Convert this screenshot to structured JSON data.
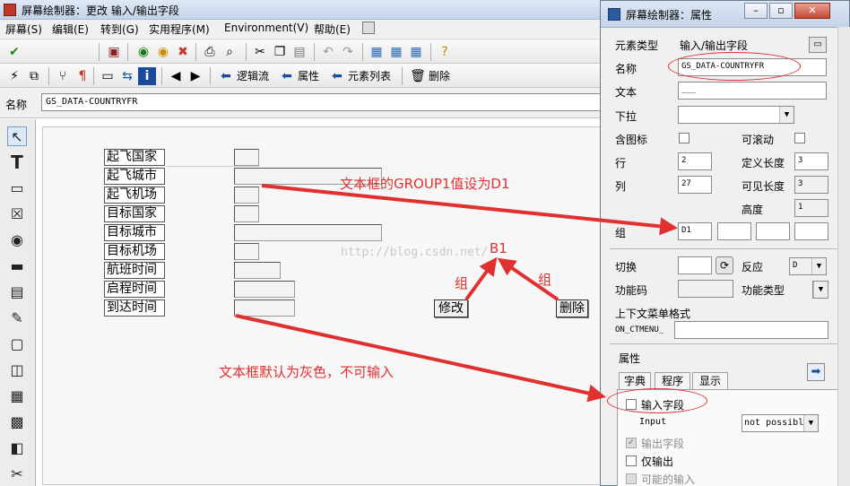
{
  "window": {
    "title": "屏幕绘制器：更改 输入/输出字段"
  },
  "menu": [
    "屏幕(S)",
    "编辑(E)",
    "转到(G)",
    "实用程序(M)",
    "Environment(V)",
    "帮助(E)"
  ],
  "toolbar2": {
    "logic_flow": "逻辑流",
    "attributes": "属性",
    "element_list": "元素列表",
    "delete": "删除"
  },
  "namebar": {
    "label": "名称",
    "value": "GS_DATA-COUNTRYFR"
  },
  "canvas": {
    "labels": [
      "起飞国家",
      "起飞城市",
      "起飞机场",
      "目标国家",
      "目标城市",
      "目标机场",
      "航班时间",
      "启程时间",
      "到达时间"
    ],
    "buttons": {
      "modify": "修改",
      "delete": "删除"
    }
  },
  "annotations": {
    "group1_d1": "文本框的GROUP1值设为D1",
    "b1": "B1",
    "group_left": "组",
    "group_right": "组",
    "watermark": "http://blog.csdn.net/",
    "gray_default": "文本框默认为灰色，不可输入"
  },
  "props": {
    "title": "屏幕绘制器：属性",
    "element_type_label": "元素类型",
    "element_type_value": "输入/输出字段",
    "name_label": "名称",
    "name_value": "GS_DATA-COUNTRYFR",
    "text_label": "文本",
    "text_value": "___",
    "dropdown_label": "下拉",
    "with_icon_label": "含图标",
    "scrollable_label": "可滚动",
    "row_label": "行",
    "row_value": "2",
    "def_length_label": "定义长度",
    "def_length_value": "3",
    "col_label": "列",
    "col_value": "27",
    "vis_length_label": "可见长度",
    "vis_length_value": "3",
    "height_label": "高度",
    "height_value": "1",
    "group_label": "组",
    "group_values": [
      "D1",
      "",
      "",
      ""
    ],
    "switch_label": "切换",
    "response_label": "反应",
    "response_value": "D",
    "func_code_label": "功能码",
    "func_type_label": "功能类型",
    "context_menu_label": "上下文菜单格式",
    "context_menu_value": "ON_CTMENU_",
    "attributes_label": "属性",
    "tabs": [
      "字典",
      "程序",
      "显示"
    ],
    "input_field_label": "输入字段",
    "input_label": "Input",
    "input_value": "not possibl",
    "output_field_label": "输出字段",
    "output_only_label": "仅输出",
    "possible_input_label": "可能的输入"
  }
}
